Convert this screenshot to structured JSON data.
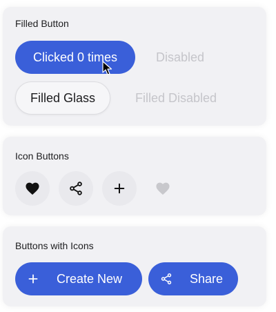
{
  "sections": {
    "filled": {
      "title": "Filled Button",
      "primary_label": "Clicked 0 times",
      "disabled_label": "Disabled",
      "glass_label": "Filled Glass",
      "glass_disabled_label": "Filled Disabled"
    },
    "icon_buttons": {
      "title": "Icon Buttons",
      "items": [
        {
          "icon": "heart-icon",
          "state": "enabled"
        },
        {
          "icon": "share-icon",
          "state": "enabled"
        },
        {
          "icon": "plus-icon",
          "state": "enabled"
        },
        {
          "icon": "heart-icon",
          "state": "disabled"
        }
      ]
    },
    "with_icons": {
      "title": "Buttons with Icons",
      "create_label": "Create New",
      "create_icon": "plus-icon",
      "share_label": "Share",
      "share_icon": "share-icon"
    }
  },
  "colors": {
    "accent": "#3a5fd9",
    "card": "#f1f1f4",
    "disabled_text": "#c5c5ca",
    "icon_dark": "#111111",
    "icon_disabled": "#c8c8cc"
  }
}
